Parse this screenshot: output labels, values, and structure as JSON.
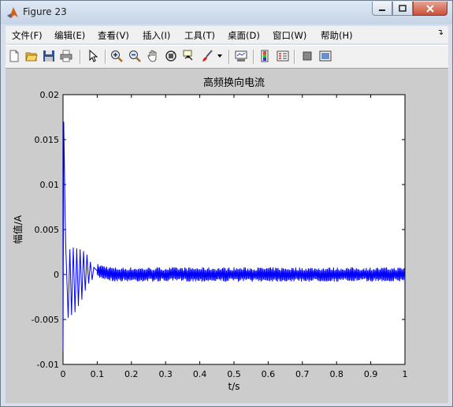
{
  "window": {
    "title": "Figure 23",
    "minimize_icon": "minimize-icon",
    "maximize_icon": "maximize-icon",
    "close_icon": "close-icon",
    "close_color": "#c7513a"
  },
  "menu": [
    {
      "id": "file",
      "label": "文件(F)"
    },
    {
      "id": "edit",
      "label": "编辑(E)"
    },
    {
      "id": "view",
      "label": "查看(V)"
    },
    {
      "id": "insert",
      "label": "插入(I)"
    },
    {
      "id": "tools",
      "label": "工具(T)"
    },
    {
      "id": "desktop",
      "label": "桌面(D)"
    },
    {
      "id": "window",
      "label": "窗口(W)"
    },
    {
      "id": "help",
      "label": "帮助(H)"
    }
  ],
  "toolbar": [
    {
      "id": "new",
      "icon": "new-figure-icon"
    },
    {
      "id": "open",
      "icon": "open-folder-icon"
    },
    {
      "id": "save",
      "icon": "save-icon"
    },
    {
      "id": "print",
      "icon": "print-icon"
    },
    {
      "id": "pointer",
      "icon": "edit-plot-arrow-icon"
    },
    {
      "id": "zoom-in",
      "icon": "zoom-in-icon"
    },
    {
      "id": "zoom-out",
      "icon": "zoom-out-icon"
    },
    {
      "id": "pan",
      "icon": "pan-hand-icon"
    },
    {
      "id": "rotate",
      "icon": "rotate-3d-icon"
    },
    {
      "id": "datacursor",
      "icon": "data-cursor-icon"
    },
    {
      "id": "brush",
      "icon": "brush-icon"
    },
    {
      "id": "link",
      "icon": "link-plot-icon"
    },
    {
      "id": "colorbar",
      "icon": "colorbar-icon"
    },
    {
      "id": "legend",
      "icon": "legend-icon"
    },
    {
      "id": "hide-tools",
      "icon": "hide-plot-tools-icon"
    },
    {
      "id": "show-tools",
      "icon": "show-plot-tools-icon"
    }
  ],
  "colors": {
    "line": "#0000ff",
    "axes_bg": "#ffffff",
    "figure_bg": "#cccccc"
  },
  "chart_data": {
    "type": "line",
    "title": "高频换向电流",
    "xlabel": "t/s",
    "ylabel": "幅值/A",
    "xlim": [
      0,
      1
    ],
    "ylim": [
      -0.01,
      0.02
    ],
    "xticks": [
      0,
      0.1,
      0.2,
      0.3,
      0.4,
      0.5,
      0.6,
      0.7,
      0.8,
      0.9,
      1
    ],
    "xtick_labels": [
      "0",
      "0.1",
      "0.2",
      "0.3",
      "0.4",
      "0.5",
      "0.6",
      "0.7",
      "0.8",
      "0.9",
      "1"
    ],
    "yticks": [
      0.02,
      0.015,
      0.01,
      0.005,
      0,
      -0.005,
      -0.01
    ],
    "ytick_labels": [
      "0.02",
      "0.015",
      "0.01",
      "0.005",
      "0",
      "-0.005",
      "-0.01"
    ],
    "grid": false,
    "series": [
      {
        "color": "#0000ff",
        "x": [
          0,
          0.002,
          0.004,
          0.006,
          0.008,
          0.01,
          0.015,
          0.02,
          0.025,
          0.03,
          0.035,
          0.04,
          0.045,
          0.05,
          0.055,
          0.06,
          0.065,
          0.07,
          0.075,
          0.08,
          0.085,
          0.09,
          0.1,
          0.15,
          0.2,
          0.3,
          0.4,
          0.5,
          0.6,
          0.7,
          0.8,
          0.9,
          1.0
        ],
        "y": [
          -0.0085,
          0.017,
          0.0125,
          0.0065,
          0.003,
          0.001,
          -0.0048,
          0.0028,
          -0.0045,
          0.003,
          -0.0042,
          0.0029,
          -0.0035,
          0.0028,
          -0.0028,
          0.0026,
          -0.0018,
          0.0022,
          -0.001,
          0.0014,
          -0.0006,
          0.0008,
          0.0004,
          0.0,
          0.0,
          0.0,
          0.0,
          0.0,
          0.0,
          0.0,
          0.0,
          0.0,
          0.0
        ],
        "noise_band": [
          -0.0008,
          0.0008
        ]
      }
    ]
  }
}
